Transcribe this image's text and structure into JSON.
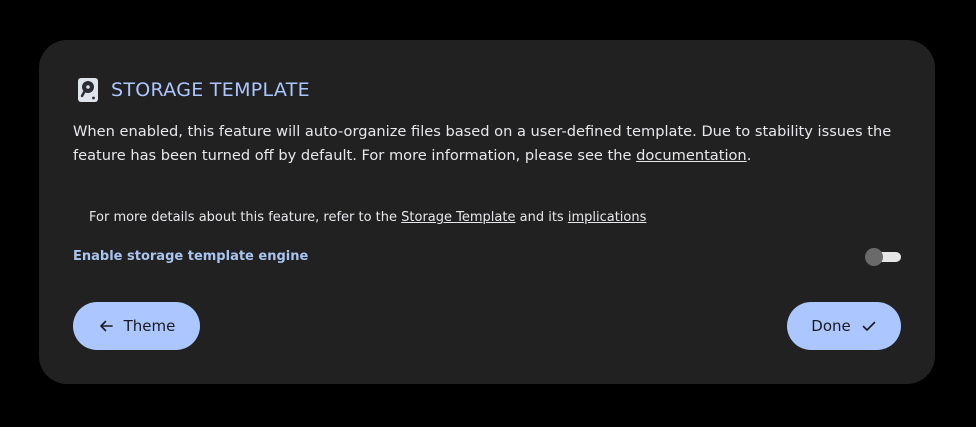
{
  "section": {
    "title": "STORAGE TEMPLATE",
    "icon": "harddisk-icon"
  },
  "description": {
    "text_before": "When enabled, this feature will auto-organize files based on a user-defined template. Due to stability issues the feature has been turned off by default. For more information, please see the ",
    "link": "documentation",
    "text_after": "."
  },
  "details": {
    "text_before": "For more details about this feature, refer to the ",
    "link1": "Storage Template",
    "text_middle": " and its ",
    "link2": "implications"
  },
  "setting": {
    "label": "Enable storage template engine",
    "enabled": false
  },
  "buttons": {
    "back_label": "Theme",
    "back_icon": "arrow-left-icon",
    "done_label": "Done",
    "done_icon": "check-icon"
  },
  "colors": {
    "accent": "#acc7ff",
    "card": "#212121",
    "background": "#000000"
  }
}
